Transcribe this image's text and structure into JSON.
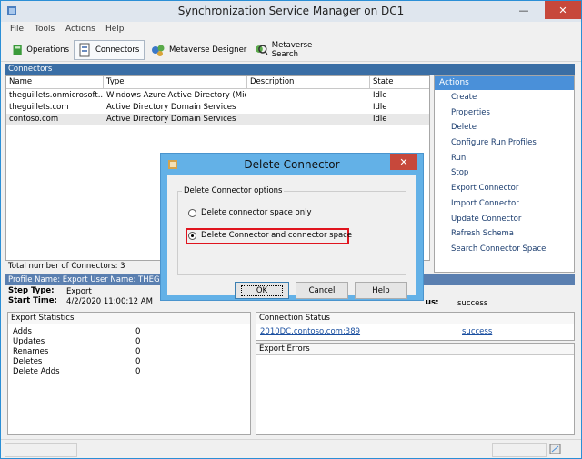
{
  "window": {
    "title": "Synchronization Service Manager on DC1"
  },
  "menu": [
    "File",
    "Tools",
    "Actions",
    "Help"
  ],
  "toolbar": {
    "operations": "Operations",
    "connectors": "Connectors",
    "metaverse_designer": "Metaverse Designer",
    "metaverse_search": "Metaverse Search"
  },
  "connectors_panel": {
    "heading": "Connectors",
    "columns": [
      "Name",
      "Type",
      "Description",
      "State"
    ],
    "rows": [
      {
        "name": "theguillets.onmicrosoft....",
        "type": "Windows Azure Active Directory (Micr...",
        "description": "",
        "state": "Idle"
      },
      {
        "name": "theguillets.com",
        "type": "Active Directory Domain Services",
        "description": "",
        "state": "Idle"
      },
      {
        "name": "contoso.com",
        "type": "Active Directory Domain Services",
        "description": "",
        "state": "Idle"
      }
    ],
    "total": "Total number of Connectors: 3"
  },
  "actions": {
    "heading": "Actions",
    "items": [
      "Create",
      "Properties",
      "Delete",
      "Configure Run Profiles",
      "Run",
      "Stop",
      "Export Connector",
      "Import Connector",
      "Update Connector",
      "Refresh Schema",
      "Search Connector Space"
    ]
  },
  "profile": {
    "bar": "Profile Name: Export  User Name: THEGUILL",
    "step_type_label": "Step Type:",
    "step_type_value": "Export",
    "start_time_label": "Start Time:",
    "start_time_value": "4/2/2020 11:00:12 AM",
    "status_label": "us:",
    "status_value": "success"
  },
  "export_statistics": {
    "heading": "Export Statistics",
    "rows": [
      {
        "label": "Adds",
        "value": "0"
      },
      {
        "label": "Updates",
        "value": "0"
      },
      {
        "label": "Renames",
        "value": "0"
      },
      {
        "label": "Deletes",
        "value": "0"
      },
      {
        "label": "Delete Adds",
        "value": "0"
      }
    ]
  },
  "connection_status": {
    "heading": "Connection Status",
    "server": "2010DC.contoso.com:389",
    "result": "success"
  },
  "export_errors": {
    "heading": "Export Errors"
  },
  "dialog": {
    "title": "Delete Connector",
    "group_label": "Delete Connector options",
    "option1": "Delete connector space only",
    "option2": "Delete Connector and connector space",
    "selected": "option2",
    "ok": "OK",
    "cancel": "Cancel",
    "help": "Help",
    "highlight_color": "#e0141e"
  },
  "colors": {
    "accent": "#4a90d9",
    "dialog_frame": "#63b1e7",
    "close": "#c7483b"
  }
}
